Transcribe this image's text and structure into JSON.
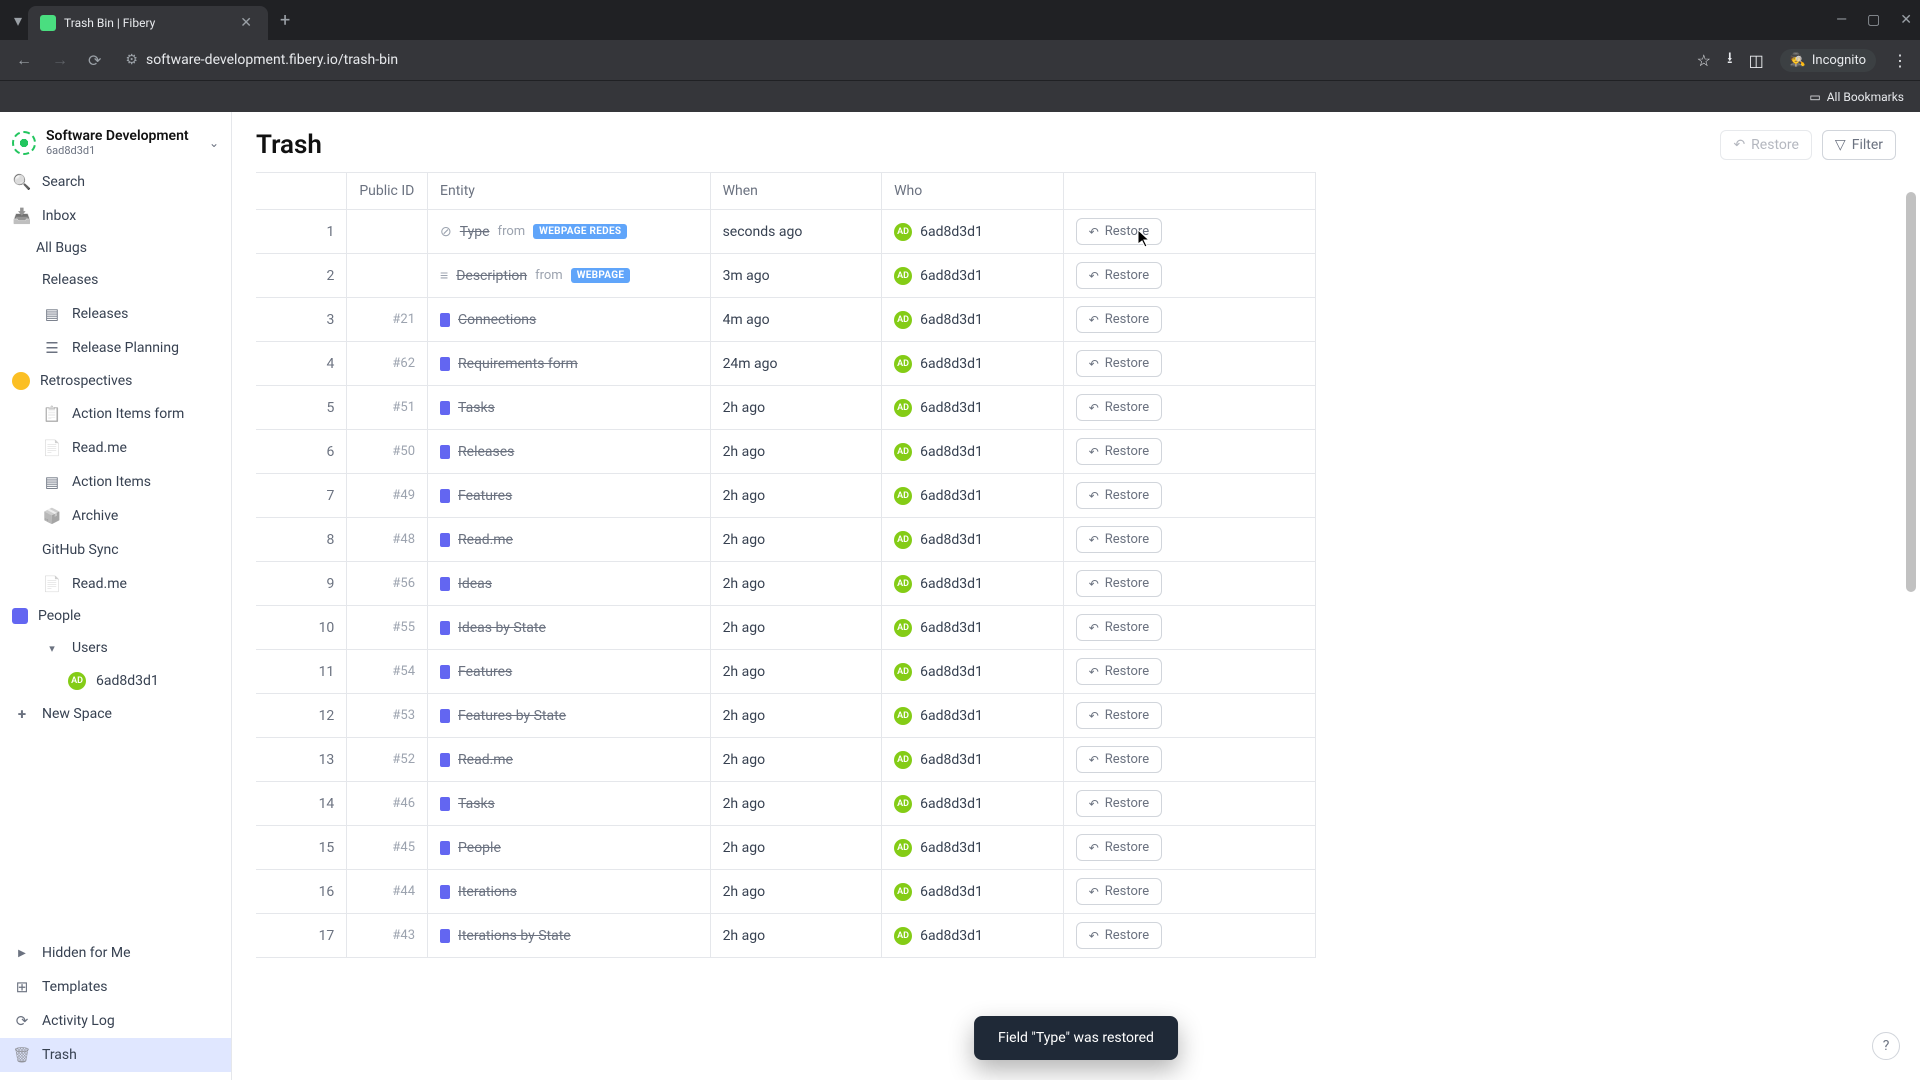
{
  "browser": {
    "tab_title": "Trash Bin | Fibery",
    "url": "software-development.fibery.io/trash-bin",
    "incognito_label": "Incognito",
    "bookmarks_label": "All Bookmarks"
  },
  "workspace": {
    "name": "Software Development",
    "id": "6ad8d3d1"
  },
  "sidebar": {
    "search": "Search",
    "inbox": "Inbox",
    "spaces": [
      {
        "label": "All Bugs",
        "icon": "grid"
      },
      {
        "label": "Releases",
        "icon": "releases",
        "children": [
          {
            "label": "Releases",
            "icon": "cards"
          },
          {
            "label": "Release Planning",
            "icon": "bars"
          }
        ]
      },
      {
        "label": "Retrospectives",
        "icon": "retro",
        "children": [
          {
            "label": "Action Items form",
            "icon": "form"
          },
          {
            "label": "Read.me",
            "icon": "doc"
          },
          {
            "label": "Action Items",
            "icon": "cards"
          },
          {
            "label": "Archive",
            "icon": "archive"
          }
        ]
      },
      {
        "label": "GitHub Sync",
        "icon": "github",
        "children": [
          {
            "label": "Read.me",
            "icon": "doc"
          }
        ]
      },
      {
        "label": "People",
        "icon": "people",
        "children": [
          {
            "label": "Users",
            "icon": "chev",
            "children": [
              {
                "label": "6ad8d3d1",
                "icon": "avatar"
              }
            ]
          }
        ]
      }
    ],
    "new_space": "New Space",
    "bottom": {
      "hidden": "Hidden for Me",
      "templates": "Templates",
      "activity": "Activity Log",
      "trash": "Trash"
    }
  },
  "page": {
    "title": "Trash",
    "restore_label": "Restore",
    "filter_label": "Filter"
  },
  "table": {
    "columns": {
      "index": "",
      "public_id": "Public ID",
      "entity": "Entity",
      "when": "When",
      "who": "Who",
      "action": ""
    },
    "restore_label": "Restore",
    "rows": [
      {
        "n": 1,
        "public_id": "",
        "entity_type": "field",
        "entity": "Type",
        "from": "from",
        "tag": "WEBPAGE REDES",
        "when": "seconds ago",
        "who": "6ad8d3d1"
      },
      {
        "n": 2,
        "public_id": "",
        "entity_type": "field",
        "entity": "Description",
        "from": "from",
        "tag": "WEBPAGE",
        "when": "3m ago",
        "who": "6ad8d3d1"
      },
      {
        "n": 3,
        "public_id": "#21",
        "entity_type": "view",
        "entity": "Connections",
        "when": "4m ago",
        "who": "6ad8d3d1"
      },
      {
        "n": 4,
        "public_id": "#62",
        "entity_type": "view",
        "entity": "Requirements form",
        "when": "24m ago",
        "who": "6ad8d3d1"
      },
      {
        "n": 5,
        "public_id": "#51",
        "entity_type": "view",
        "entity": "Tasks",
        "when": "2h ago",
        "who": "6ad8d3d1"
      },
      {
        "n": 6,
        "public_id": "#50",
        "entity_type": "view",
        "entity": "Releases",
        "when": "2h ago",
        "who": "6ad8d3d1"
      },
      {
        "n": 7,
        "public_id": "#49",
        "entity_type": "view",
        "entity": "Features",
        "when": "2h ago",
        "who": "6ad8d3d1"
      },
      {
        "n": 8,
        "public_id": "#48",
        "entity_type": "view",
        "entity": "Read.me",
        "when": "2h ago",
        "who": "6ad8d3d1"
      },
      {
        "n": 9,
        "public_id": "#56",
        "entity_type": "view",
        "entity": "Ideas",
        "when": "2h ago",
        "who": "6ad8d3d1"
      },
      {
        "n": 10,
        "public_id": "#55",
        "entity_type": "view",
        "entity": "Ideas by State",
        "when": "2h ago",
        "who": "6ad8d3d1"
      },
      {
        "n": 11,
        "public_id": "#54",
        "entity_type": "view",
        "entity": "Features",
        "when": "2h ago",
        "who": "6ad8d3d1"
      },
      {
        "n": 12,
        "public_id": "#53",
        "entity_type": "view",
        "entity": "Features by State",
        "when": "2h ago",
        "who": "6ad8d3d1"
      },
      {
        "n": 13,
        "public_id": "#52",
        "entity_type": "view",
        "entity": "Read.me",
        "when": "2h ago",
        "who": "6ad8d3d1"
      },
      {
        "n": 14,
        "public_id": "#46",
        "entity_type": "view",
        "entity": "Tasks",
        "when": "2h ago",
        "who": "6ad8d3d1"
      },
      {
        "n": 15,
        "public_id": "#45",
        "entity_type": "view",
        "entity": "People",
        "when": "2h ago",
        "who": "6ad8d3d1"
      },
      {
        "n": 16,
        "public_id": "#44",
        "entity_type": "view",
        "entity": "Iterations",
        "when": "2h ago",
        "who": "6ad8d3d1"
      },
      {
        "n": 17,
        "public_id": "#43",
        "entity_type": "view",
        "entity": "Iterations by State",
        "when": "2h ago",
        "who": "6ad8d3d1"
      }
    ]
  },
  "toast": {
    "message": "Field \"Type\" was restored"
  },
  "avatar_initials": "AD",
  "help_label": "?"
}
